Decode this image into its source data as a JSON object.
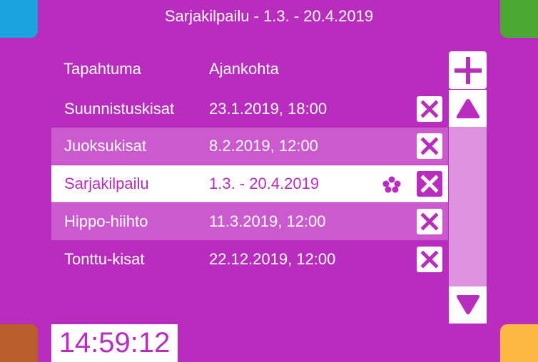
{
  "title": "Sarjakilpailu - 1.3. - 20.4.2019",
  "columns": {
    "event": "Tapahtuma",
    "time": "Ajankohta"
  },
  "rows": [
    {
      "name": "Suunnistuskisat",
      "date": "23.1.2019, 18:00"
    },
    {
      "name": "Juoksukisat",
      "date": "8.2.2019, 12:00"
    },
    {
      "name": "Sarjakilpailu",
      "date": "1.3. - 20.4.2019",
      "selected": true,
      "icon": "flower-icon"
    },
    {
      "name": "Hippo-hiihto",
      "date": "11.3.2019, 12:00"
    },
    {
      "name": "Tonttu-kisat",
      "date": "22.12.2019, 12:00"
    }
  ],
  "clock": "14:59:12",
  "icons": {
    "add": "plus-icon",
    "delete": "close-x-icon",
    "scroll_up": "triangle-up-icon",
    "scroll_down": "triangle-down-icon"
  },
  "colors": {
    "background": "#b82dbe",
    "row_alt": "#cc5acf",
    "scroll_track": "#dd92e0",
    "corner_top_left": "#1aa3df",
    "corner_top_right": "#4aa933",
    "corner_bottom_left": "#b85e2b",
    "corner_bottom_right": "#fdb844"
  }
}
